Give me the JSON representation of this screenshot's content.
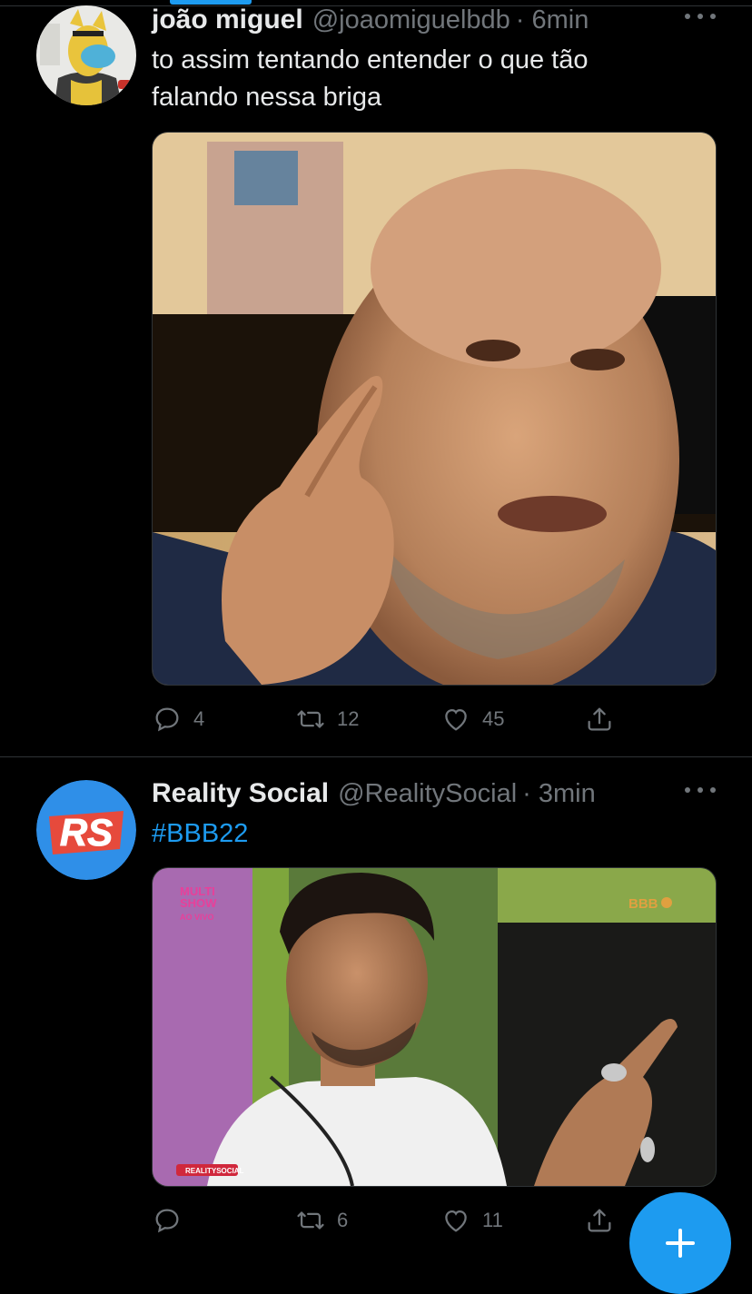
{
  "tweets": [
    {
      "name": "joão miguel",
      "handle": "@joaomiguelbdb",
      "time": "· 6min",
      "text_lines": [
        "to assim tentando entender o que tão",
        "falando nessa briga"
      ],
      "media_icon": "man-pointing-to-ear-photo",
      "replies": "4",
      "retweets": "12",
      "likes": "45"
    },
    {
      "name": "Reality Social",
      "handle": "@RealitySocial",
      "time": "· 3min",
      "hashtag": "#BBB22",
      "avatar_text": "RS",
      "media_icon": "man-pointing-photo",
      "media_overlay": {
        "channel_top": "MULTI",
        "channel_mid": "SHOW",
        "channel_sub": "AO VIVO",
        "show_logo": "BBB",
        "watermark": "REALITYSOCIAL"
      },
      "replies": "",
      "retweets": "6",
      "likes": "11"
    }
  ],
  "colors": {
    "accent": "#1d9bf0",
    "background": "#000000",
    "text": "#e7e9ea",
    "muted": "#71767b"
  },
  "fab": {
    "icon": "compose-plus-icon"
  }
}
